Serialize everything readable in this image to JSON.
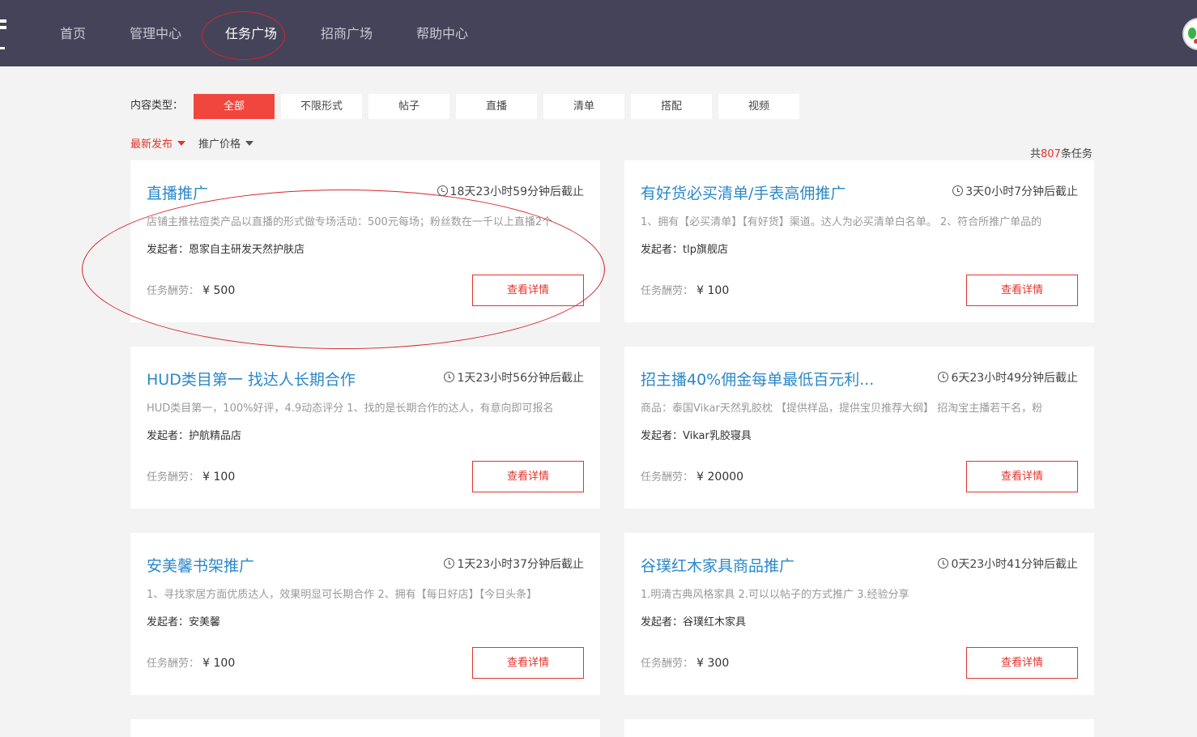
{
  "header": {
    "nav": [
      {
        "label": "首页"
      },
      {
        "label": "管理中心"
      },
      {
        "label": "任务广场"
      },
      {
        "label": "招商广场"
      },
      {
        "label": "帮助中心"
      }
    ],
    "active_index": 2
  },
  "filters": {
    "content_type_label": "内容类型：",
    "types": [
      "全部",
      "不限形式",
      "帖子",
      "直播",
      "清单",
      "搭配",
      "视频"
    ],
    "active_type_index": 0
  },
  "sort": {
    "latest_label": "最新发布",
    "price_label": "推广价格"
  },
  "total": {
    "prefix": "共",
    "count": "807",
    "suffix": "条任务"
  },
  "card_labels": {
    "sponsor_prefix": "发起者：",
    "reward_prefix": "任务酬劳：",
    "detail_button": "查看详情"
  },
  "tasks": [
    {
      "title": "直播推广",
      "deadline": "18天23小时59分钟后截止",
      "desc": "店铺主推祛痘类产品以直播的形式做专场活动：500元每场；粉丝数在一千以上直播2个",
      "sponsor": "恩家自主研发天然护肤店",
      "reward": "¥ 500"
    },
    {
      "title": "有好货必买清单/手表高佣推广",
      "deadline": "3天0小时7分钟后截止",
      "desc": "1、拥有【必买清单】【有好货】渠道。达人为必买清单白名单。 2、符合所推广单品的",
      "sponsor": "tlp旗舰店",
      "reward": "¥ 100"
    },
    {
      "title": "HUD类目第一 找达人长期合作",
      "deadline": "1天23小时56分钟后截止",
      "desc": "HUD类目第一，100%好评，4.9动态评分 1、找的是长期合作的达人，有意向即可报名",
      "sponsor": "护航精品店",
      "reward": "¥ 100"
    },
    {
      "title": "招主播40%佣金每单最低百元利...",
      "deadline": "6天23小时49分钟后截止",
      "desc": "商品：泰国Vikar天然乳胶枕 【提供样品，提供宝贝推荐大纲】 招淘宝主播若干名，粉",
      "sponsor": "Vikar乳胶寝具",
      "reward": "¥ 20000"
    },
    {
      "title": "安美馨书架推广",
      "deadline": "1天23小时37分钟后截止",
      "desc": "1、寻找家居方面优质达人，效果明显可长期合作 2、拥有【每日好店】【今日头条】",
      "sponsor": "安美馨",
      "reward": "¥ 100"
    },
    {
      "title": "谷璞红木家具商品推广",
      "deadline": "0天23小时41分钟后截止",
      "desc": "1.明清古典风格家具 2.可以以帖子的方式推广 3.经验分享",
      "sponsor": "谷璞红木家具",
      "reward": "¥ 300"
    }
  ]
}
